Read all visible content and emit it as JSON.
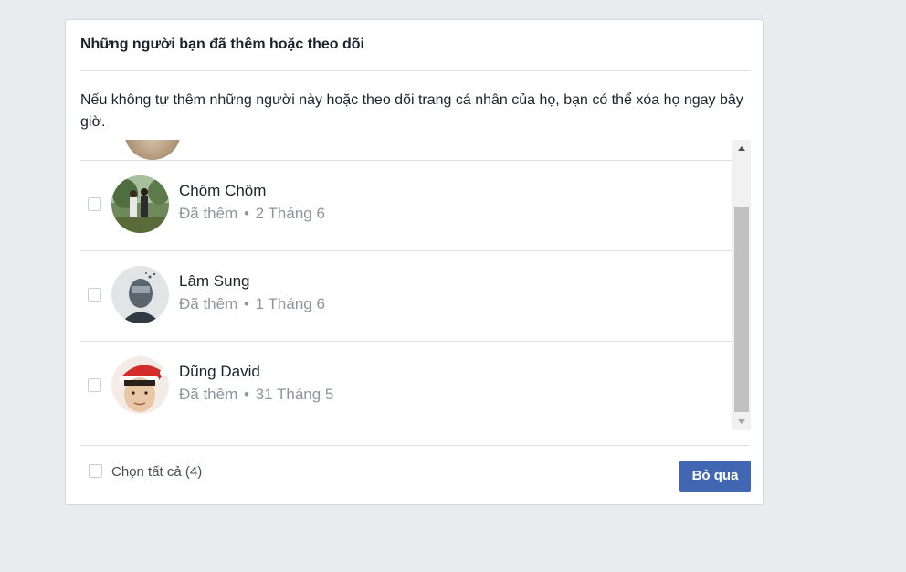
{
  "dialog": {
    "title": "Những người bạn đã thêm hoặc theo dõi",
    "description": "Nếu không tự thêm những người này hoặc theo dõi trang cá nhân của họ, bạn có thể xóa họ ngay bây giờ.",
    "people": [
      {
        "name": "Chôm Chôm",
        "status": "Đã thêm",
        "date": "2 Tháng 6",
        "checked": false
      },
      {
        "name": "Lâm Sung",
        "status": "Đã thêm",
        "date": "1 Tháng 6",
        "checked": false
      },
      {
        "name": "Dũng David",
        "status": "Đã thêm",
        "date": "31 Tháng 5",
        "checked": false
      }
    ],
    "meta_separator": "•",
    "select_all_label": "Chọn tất cả (4)",
    "skip_label": "Bỏ qua"
  },
  "colors": {
    "primary_button": "#4267b2",
    "page_background": "#e9ebee",
    "meta_text": "#90949c"
  },
  "scroll": {
    "position_fraction": 0.33
  }
}
